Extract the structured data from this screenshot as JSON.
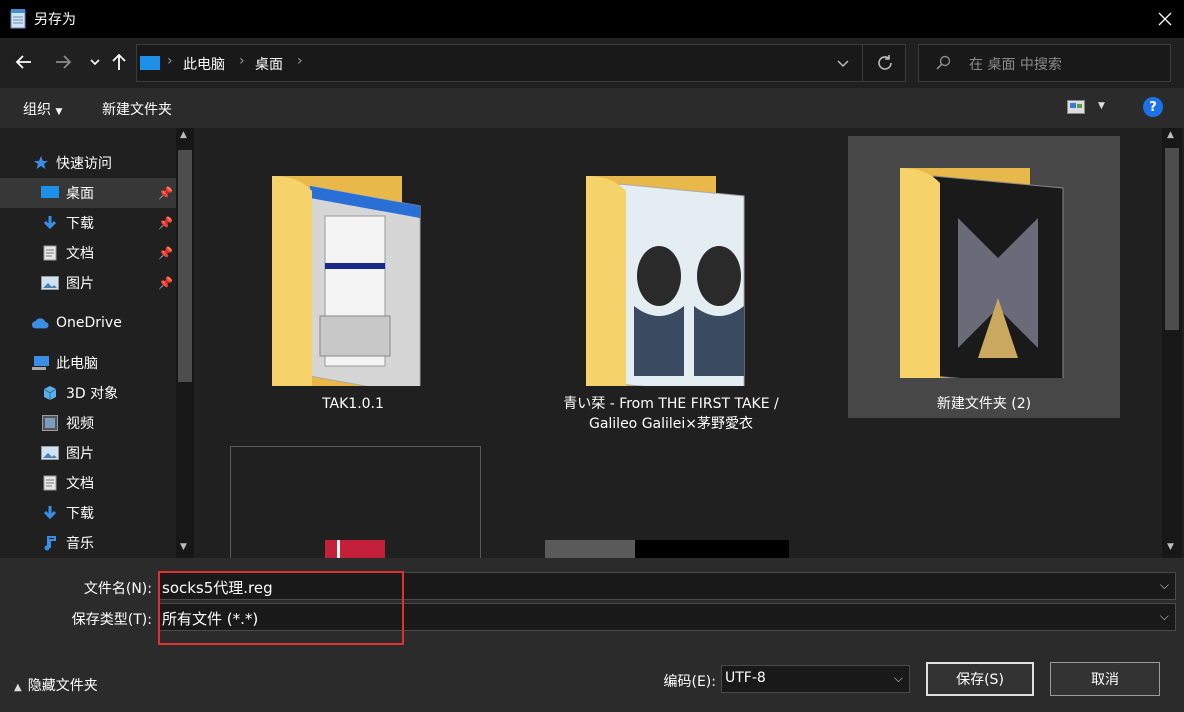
{
  "window": {
    "title": "另存为",
    "close_icon": "close-icon"
  },
  "nav": {
    "back_icon": "arrow-left-icon",
    "forward_icon": "arrow-right-icon",
    "recent_icon": "chevron-down-icon",
    "up_icon": "arrow-up-icon",
    "breadcrumbs": [
      "此电脑",
      "桌面"
    ],
    "refresh_icon": "refresh-icon",
    "search_placeholder": "在 桌面 中搜索"
  },
  "commands": {
    "organize": "组织",
    "new_folder": "新建文件夹"
  },
  "sidebar": {
    "items": [
      {
        "label": "快速访问",
        "icon": "star-icon"
      },
      {
        "label": "桌面",
        "icon": "desktop-icon",
        "pinned": true,
        "selected": true
      },
      {
        "label": "下载",
        "icon": "download-icon",
        "pinned": true
      },
      {
        "label": "文档",
        "icon": "document-icon",
        "pinned": true
      },
      {
        "label": "图片",
        "icon": "picture-icon",
        "pinned": true
      },
      {
        "label": "OneDrive",
        "icon": "cloud-icon"
      },
      {
        "label": "此电脑",
        "icon": "computer-icon"
      },
      {
        "label": "3D 对象",
        "icon": "cube-icon"
      },
      {
        "label": "视频",
        "icon": "video-icon"
      },
      {
        "label": "图片",
        "icon": "picture-icon"
      },
      {
        "label": "文档",
        "icon": "document-icon"
      },
      {
        "label": "下载",
        "icon": "download-icon"
      },
      {
        "label": "音乐",
        "icon": "music-icon"
      }
    ]
  },
  "folders": [
    {
      "line1": "TAK1.0.1",
      "line2": ""
    },
    {
      "line1": "青い栞 - From THE FIRST TAKE /",
      "line2": "Galileo Galilei×茅野愛衣"
    },
    {
      "line1": "新建文件夹 (2)",
      "line2": "",
      "selected": true
    }
  ],
  "form": {
    "filename_label": "文件名(N):",
    "filename_value": "socks5代理.reg",
    "type_label": "保存类型(T):",
    "type_value": "所有文件  (*.*)",
    "hide_folders": "隐藏文件夹",
    "encoding_label": "编码(E):",
    "encoding_value": "UTF-8",
    "save": "保存(S)",
    "cancel": "取消"
  },
  "colors": {
    "highlight_box": "#e03030",
    "help_blue": "#1a73e8",
    "folder": "#f6d26b"
  }
}
